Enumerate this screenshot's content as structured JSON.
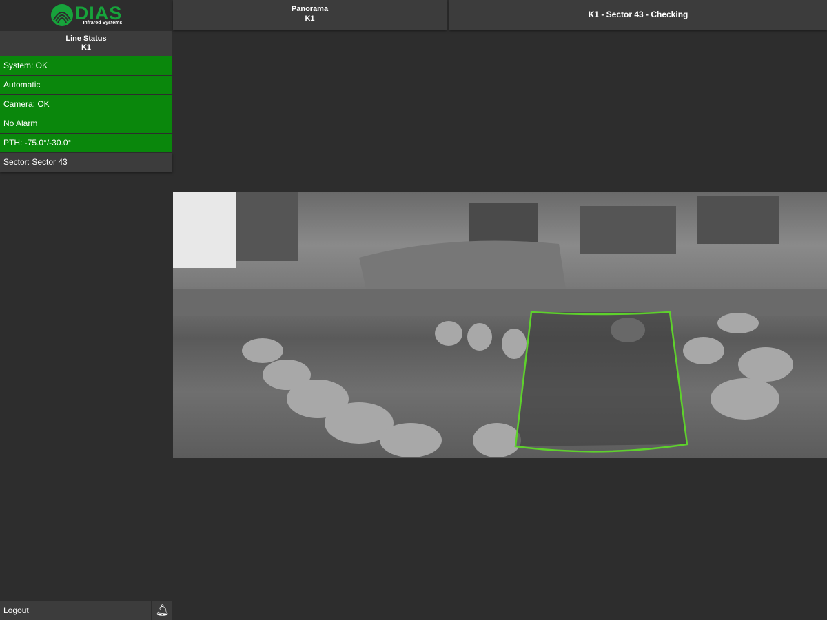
{
  "logo": {
    "brand": "DIAS",
    "subtitle": "Infrared Systems"
  },
  "line_status": {
    "title": "Line Status",
    "line": "K1"
  },
  "status_items": [
    {
      "label": "System: OK",
      "state": "ok"
    },
    {
      "label": "Automatic",
      "state": "ok"
    },
    {
      "label": "Camera: OK",
      "state": "ok"
    },
    {
      "label": "No Alarm",
      "state": "ok"
    },
    {
      "label": "PTH: -75.0°/-30.0°",
      "state": "ok"
    }
  ],
  "sector": {
    "label": "Sector: Sector 43"
  },
  "tabs": {
    "panorama_title": "Panorama",
    "panorama_line": "K1",
    "current_view": "K1 - Sector 43 - Checking"
  },
  "footer": {
    "logout": "Logout"
  },
  "colors": {
    "ok": "#0a870c",
    "sector_outline": "#5ed12c",
    "brand": "#17a33b"
  }
}
